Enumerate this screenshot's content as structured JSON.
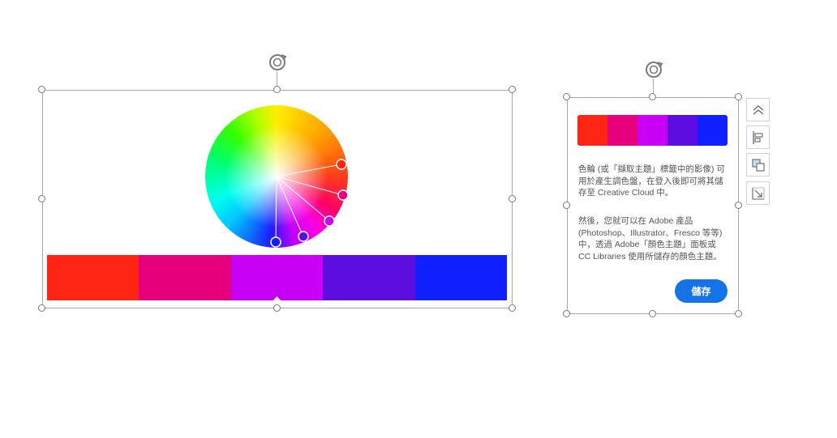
{
  "palette": {
    "swatches": [
      "#ff2414",
      "#e6007e",
      "#c800f5",
      "#5c0ee0",
      "#1020ff"
    ]
  },
  "panel": {
    "paragraph1": "色輪 (或「擷取主題」標籤中的影像) 可用於產生調色盤，在登入後即可將其儲存至 Creative Cloud 中。",
    "paragraph2": "然後，您就可以在 Adobe 產品 (Photoshop、Illustrator、Fresco 等等) 中，透過 Adobe「顏色主題」面板或 CC Libraries 使用所儲存的顏色主題。",
    "save_label": "儲存"
  },
  "icons": {
    "rotate": "rotate-handle-icon",
    "toolbar": [
      "bring-forward-icon",
      "align-left-icon",
      "arrange-icon",
      "resize-icon"
    ]
  }
}
